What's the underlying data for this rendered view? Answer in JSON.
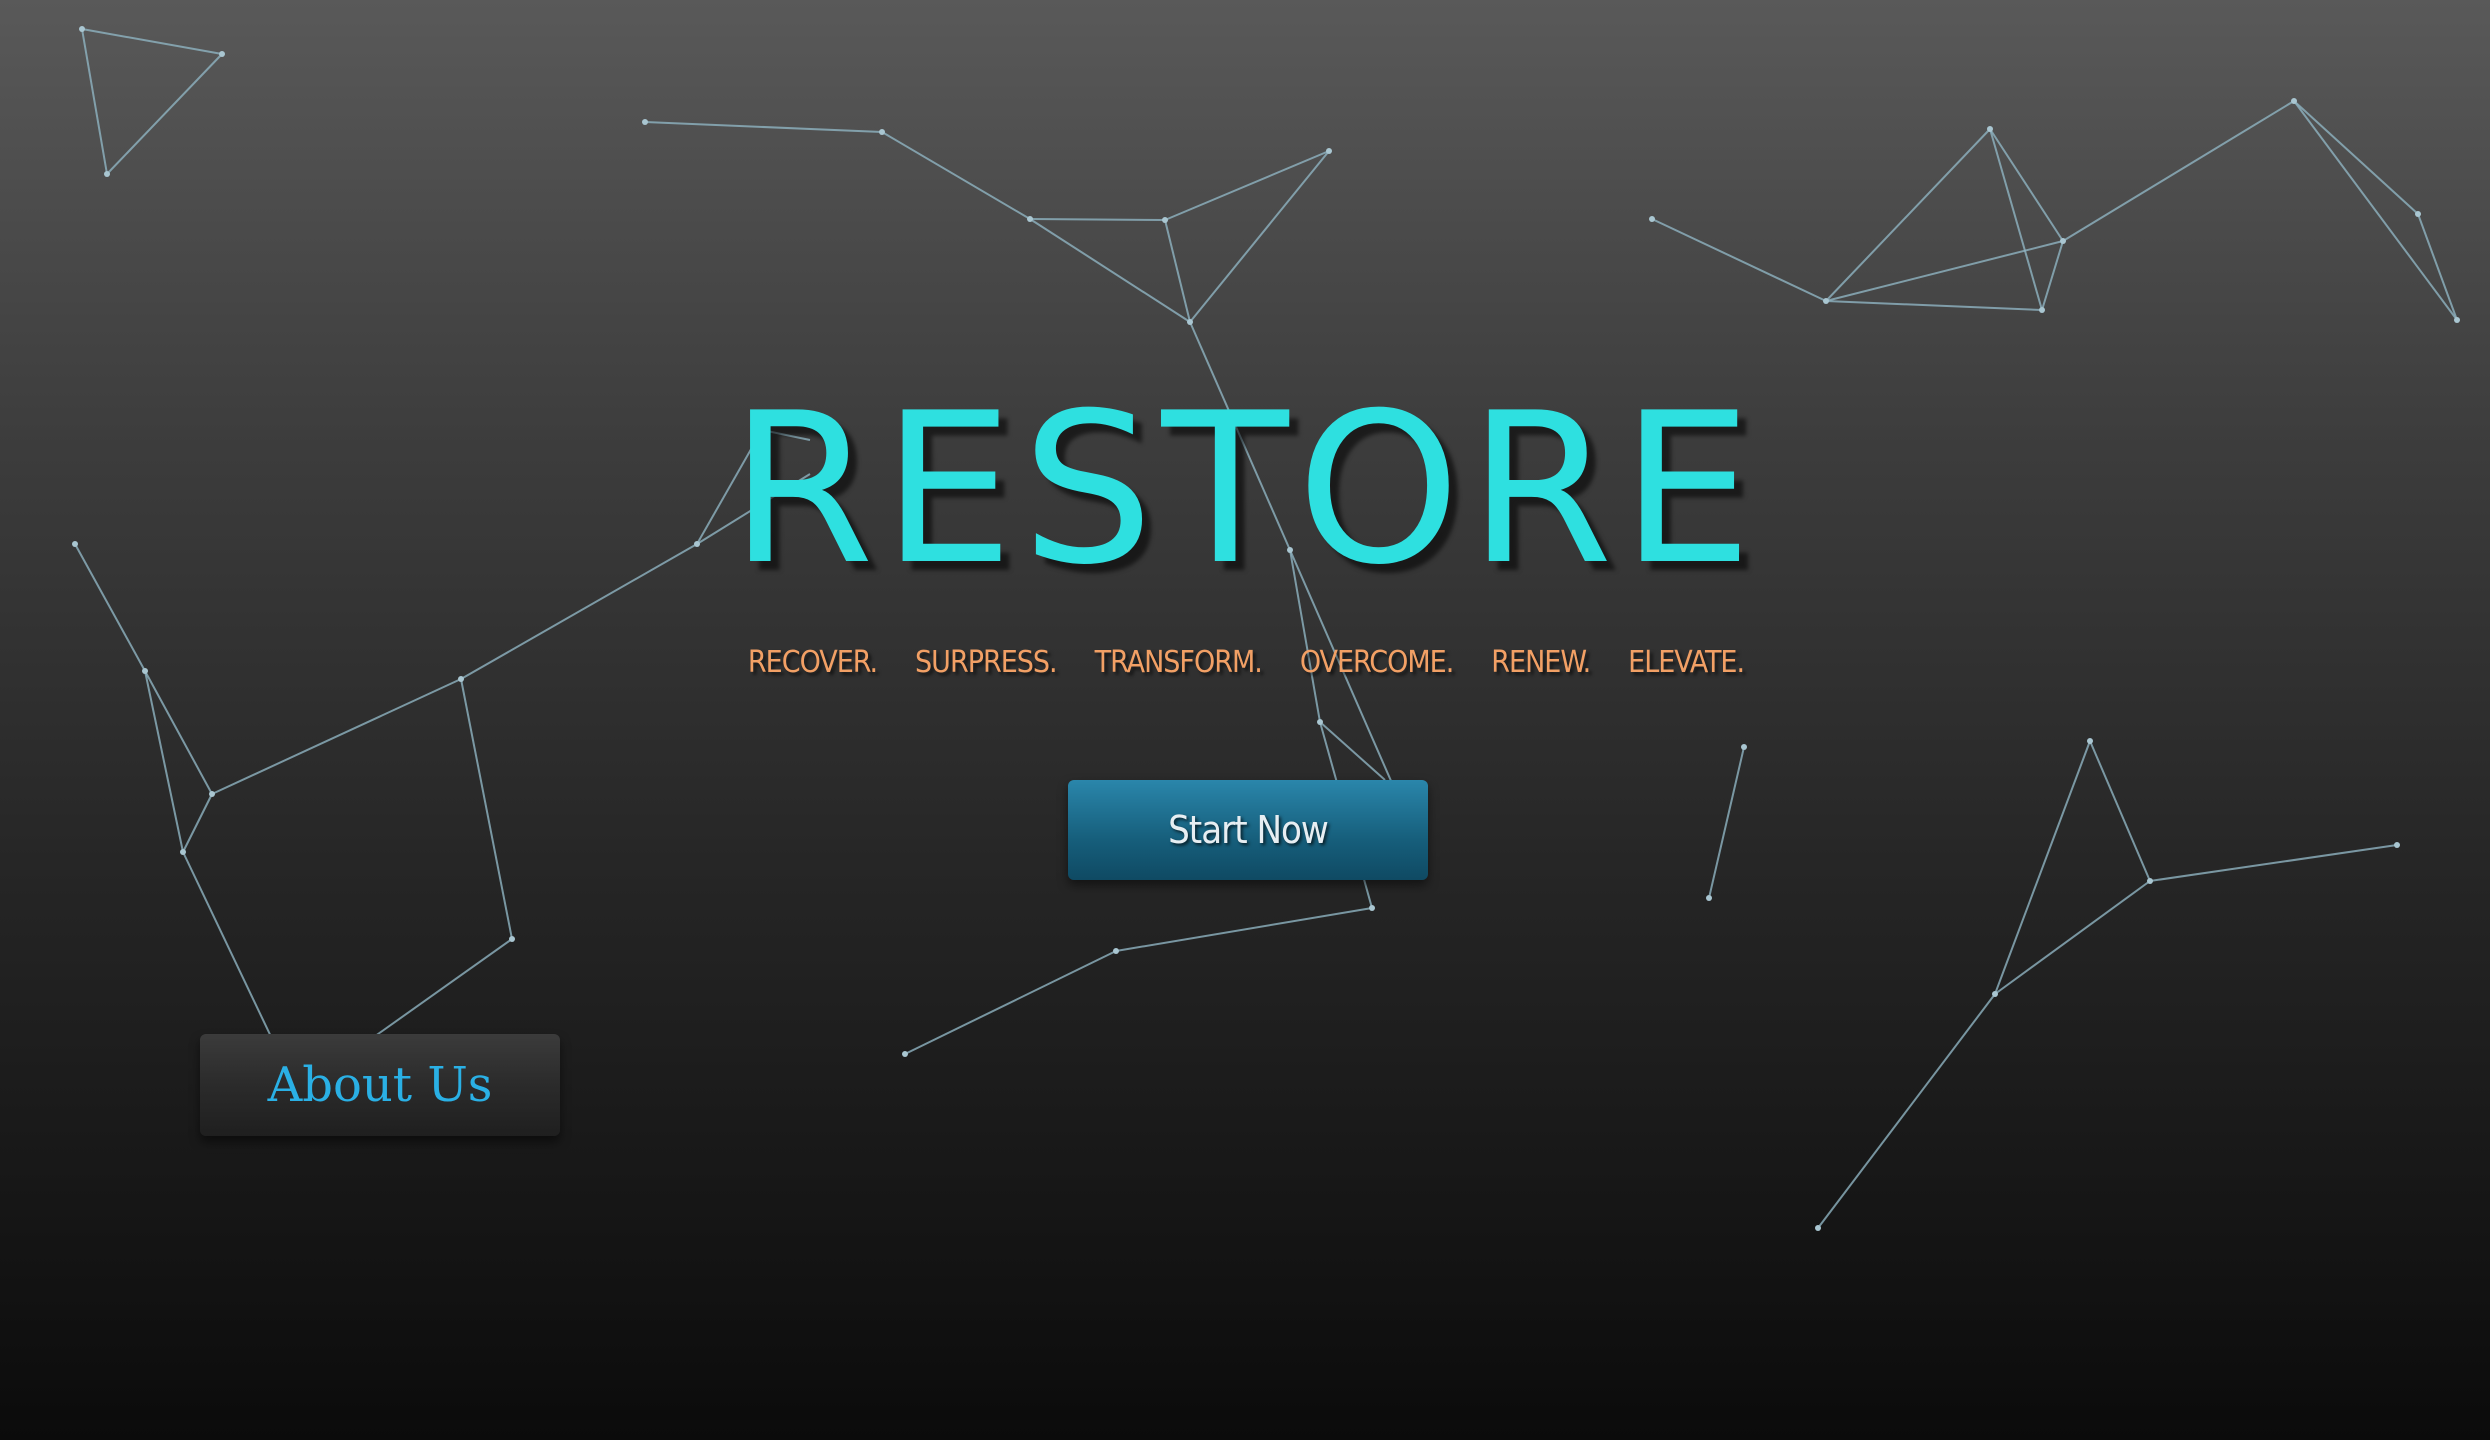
{
  "hero": {
    "title": "RESTORE",
    "taglines": [
      "RECOVER.",
      "SURPRESS.",
      "TRANSFORM.",
      "OVERCOME.",
      "RENEW.",
      "ELEVATE."
    ],
    "start_button_label": "Start Now",
    "about_button_label": "About Us"
  },
  "colors": {
    "title": "#2ee0e0",
    "tagline": "#f2a065",
    "start_button": "#1f7196",
    "about_text": "#2ab0e5",
    "network_lines": "#8fb4c2"
  }
}
